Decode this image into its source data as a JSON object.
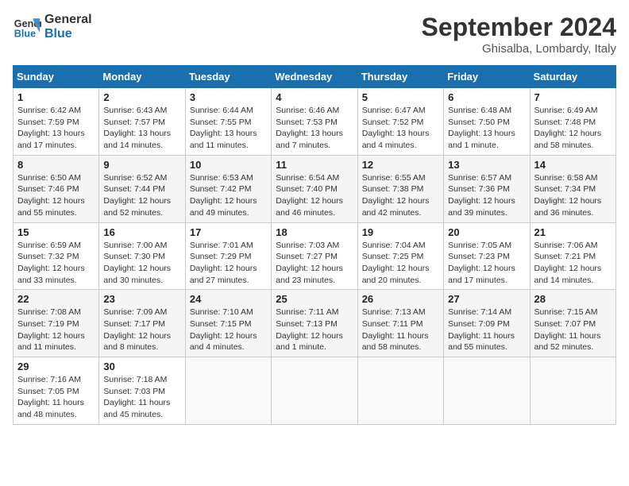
{
  "header": {
    "logo_line1": "General",
    "logo_line2": "Blue",
    "month_title": "September 2024",
    "location": "Ghisalba, Lombardy, Italy"
  },
  "weekdays": [
    "Sunday",
    "Monday",
    "Tuesday",
    "Wednesday",
    "Thursday",
    "Friday",
    "Saturday"
  ],
  "weeks": [
    [
      {
        "day": "1",
        "info": "Sunrise: 6:42 AM\nSunset: 7:59 PM\nDaylight: 13 hours and 17 minutes."
      },
      {
        "day": "2",
        "info": "Sunrise: 6:43 AM\nSunset: 7:57 PM\nDaylight: 13 hours and 14 minutes."
      },
      {
        "day": "3",
        "info": "Sunrise: 6:44 AM\nSunset: 7:55 PM\nDaylight: 13 hours and 11 minutes."
      },
      {
        "day": "4",
        "info": "Sunrise: 6:46 AM\nSunset: 7:53 PM\nDaylight: 13 hours and 7 minutes."
      },
      {
        "day": "5",
        "info": "Sunrise: 6:47 AM\nSunset: 7:52 PM\nDaylight: 13 hours and 4 minutes."
      },
      {
        "day": "6",
        "info": "Sunrise: 6:48 AM\nSunset: 7:50 PM\nDaylight: 13 hours and 1 minute."
      },
      {
        "day": "7",
        "info": "Sunrise: 6:49 AM\nSunset: 7:48 PM\nDaylight: 12 hours and 58 minutes."
      }
    ],
    [
      {
        "day": "8",
        "info": "Sunrise: 6:50 AM\nSunset: 7:46 PM\nDaylight: 12 hours and 55 minutes."
      },
      {
        "day": "9",
        "info": "Sunrise: 6:52 AM\nSunset: 7:44 PM\nDaylight: 12 hours and 52 minutes."
      },
      {
        "day": "10",
        "info": "Sunrise: 6:53 AM\nSunset: 7:42 PM\nDaylight: 12 hours and 49 minutes."
      },
      {
        "day": "11",
        "info": "Sunrise: 6:54 AM\nSunset: 7:40 PM\nDaylight: 12 hours and 46 minutes."
      },
      {
        "day": "12",
        "info": "Sunrise: 6:55 AM\nSunset: 7:38 PM\nDaylight: 12 hours and 42 minutes."
      },
      {
        "day": "13",
        "info": "Sunrise: 6:57 AM\nSunset: 7:36 PM\nDaylight: 12 hours and 39 minutes."
      },
      {
        "day": "14",
        "info": "Sunrise: 6:58 AM\nSunset: 7:34 PM\nDaylight: 12 hours and 36 minutes."
      }
    ],
    [
      {
        "day": "15",
        "info": "Sunrise: 6:59 AM\nSunset: 7:32 PM\nDaylight: 12 hours and 33 minutes."
      },
      {
        "day": "16",
        "info": "Sunrise: 7:00 AM\nSunset: 7:30 PM\nDaylight: 12 hours and 30 minutes."
      },
      {
        "day": "17",
        "info": "Sunrise: 7:01 AM\nSunset: 7:29 PM\nDaylight: 12 hours and 27 minutes."
      },
      {
        "day": "18",
        "info": "Sunrise: 7:03 AM\nSunset: 7:27 PM\nDaylight: 12 hours and 23 minutes."
      },
      {
        "day": "19",
        "info": "Sunrise: 7:04 AM\nSunset: 7:25 PM\nDaylight: 12 hours and 20 minutes."
      },
      {
        "day": "20",
        "info": "Sunrise: 7:05 AM\nSunset: 7:23 PM\nDaylight: 12 hours and 17 minutes."
      },
      {
        "day": "21",
        "info": "Sunrise: 7:06 AM\nSunset: 7:21 PM\nDaylight: 12 hours and 14 minutes."
      }
    ],
    [
      {
        "day": "22",
        "info": "Sunrise: 7:08 AM\nSunset: 7:19 PM\nDaylight: 12 hours and 11 minutes."
      },
      {
        "day": "23",
        "info": "Sunrise: 7:09 AM\nSunset: 7:17 PM\nDaylight: 12 hours and 8 minutes."
      },
      {
        "day": "24",
        "info": "Sunrise: 7:10 AM\nSunset: 7:15 PM\nDaylight: 12 hours and 4 minutes."
      },
      {
        "day": "25",
        "info": "Sunrise: 7:11 AM\nSunset: 7:13 PM\nDaylight: 12 hours and 1 minute."
      },
      {
        "day": "26",
        "info": "Sunrise: 7:13 AM\nSunset: 7:11 PM\nDaylight: 11 hours and 58 minutes."
      },
      {
        "day": "27",
        "info": "Sunrise: 7:14 AM\nSunset: 7:09 PM\nDaylight: 11 hours and 55 minutes."
      },
      {
        "day": "28",
        "info": "Sunrise: 7:15 AM\nSunset: 7:07 PM\nDaylight: 11 hours and 52 minutes."
      }
    ],
    [
      {
        "day": "29",
        "info": "Sunrise: 7:16 AM\nSunset: 7:05 PM\nDaylight: 11 hours and 48 minutes."
      },
      {
        "day": "30",
        "info": "Sunrise: 7:18 AM\nSunset: 7:03 PM\nDaylight: 11 hours and 45 minutes."
      },
      {
        "day": "",
        "info": ""
      },
      {
        "day": "",
        "info": ""
      },
      {
        "day": "",
        "info": ""
      },
      {
        "day": "",
        "info": ""
      },
      {
        "day": "",
        "info": ""
      }
    ]
  ]
}
